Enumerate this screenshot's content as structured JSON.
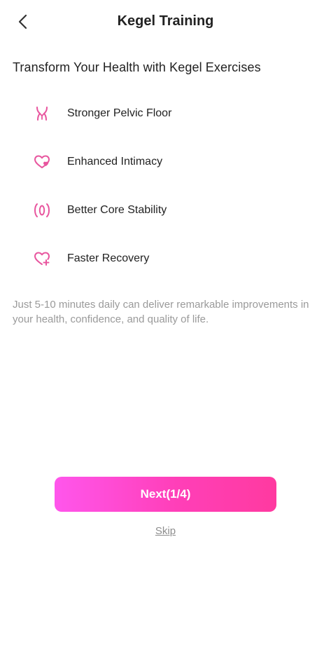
{
  "header": {
    "title": "Kegel Training",
    "back_icon": "chevron-left-icon"
  },
  "intro": {
    "headline": "Transform Your Health with Kegel Exercises"
  },
  "benefits": [
    {
      "icon": "pelvis-icon",
      "label": "Stronger Pelvic Floor"
    },
    {
      "icon": "heart-icon",
      "label": "Enhanced Intimacy"
    },
    {
      "icon": "core-icon",
      "label": "Better Core Stability"
    },
    {
      "icon": "heart-plus-icon",
      "label": "Faster Recovery"
    }
  ],
  "note": "Just 5-10 minutes daily can deliver remarkable improvements in your health, confidence, and quality of life.",
  "actions": {
    "next_label": "Next(1/4)",
    "skip_label": "Skip"
  },
  "colors": {
    "accent": "#ff4fc8",
    "icon": "#e8559e",
    "gradient_start": "#ff56ec",
    "gradient_end": "#ff3aa0",
    "muted_text": "#9a9a9a"
  }
}
